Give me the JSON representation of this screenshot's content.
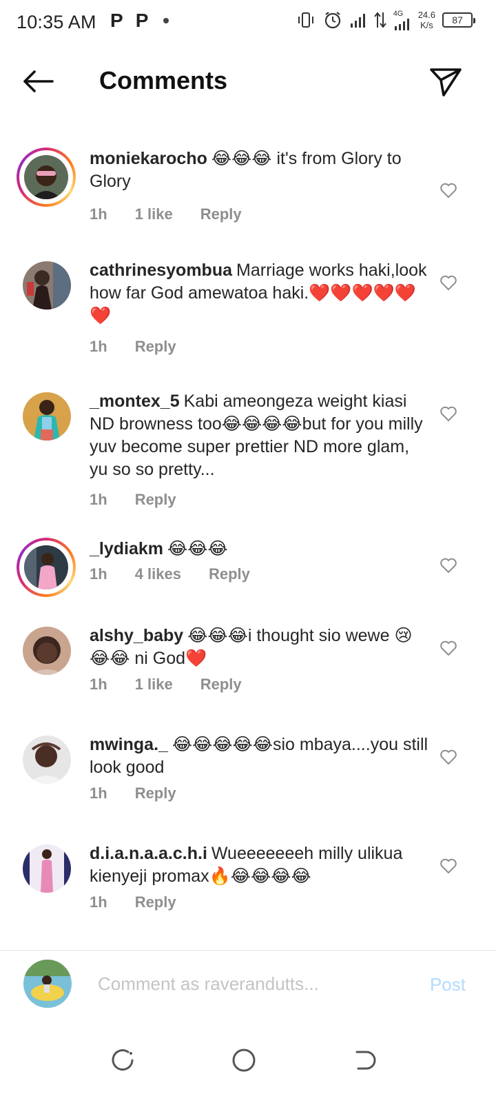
{
  "status": {
    "time": "10:35 AM",
    "left_icons": [
      "P",
      "P"
    ],
    "network": "4G",
    "speed_value": "24.6",
    "speed_unit": "K/s",
    "battery": "87"
  },
  "header": {
    "title": "Comments"
  },
  "comments": [
    {
      "username": "moniekarocho",
      "text": "😂😂😂 it's from Glory to Glory",
      "time": "1h",
      "likes": "1 like",
      "reply": "Reply"
    },
    {
      "username": "cathrinesyombua",
      "text": "Marriage works haki,look how far God amewatoa haki.❤️❤️❤️❤️❤️❤️",
      "time": "1h",
      "likes": "",
      "reply": "Reply"
    },
    {
      "username": "_montex_5",
      "text": "Kabi ameongeza weight kiasi ND browness too😂😂😂😂but for you milly yuv become super prettier ND more glam, yu so so pretty...",
      "time": "1h",
      "likes": "",
      "reply": "Reply"
    },
    {
      "username": "_lydiakm",
      "text": "😂😂😂",
      "time": "1h",
      "likes": "4 likes",
      "reply": "Reply"
    },
    {
      "username": "alshy_baby",
      "text": "😂😂😂i thought sio wewe 😢😂😂 ni God❤️",
      "time": "1h",
      "likes": "1 like",
      "reply": "Reply"
    },
    {
      "username": "mwinga._",
      "text": "😂😂😂😂😂sio mbaya....you still look good",
      "time": "1h",
      "likes": "",
      "reply": "Reply"
    },
    {
      "username": "d.i.a.n.a.a.c.h.i",
      "text": "Wueeeeeeeh milly ulikua kienyeji promax🔥😂😂😂😂",
      "time": "1h",
      "likes": "",
      "reply": "Reply"
    }
  ],
  "compose": {
    "placeholder": "Comment as raverandutts...",
    "post_label": "Post"
  },
  "colors": {
    "accent_post": "#b3dbff",
    "meta_gray": "#8e8e8e",
    "story_ring": "#d62976"
  }
}
